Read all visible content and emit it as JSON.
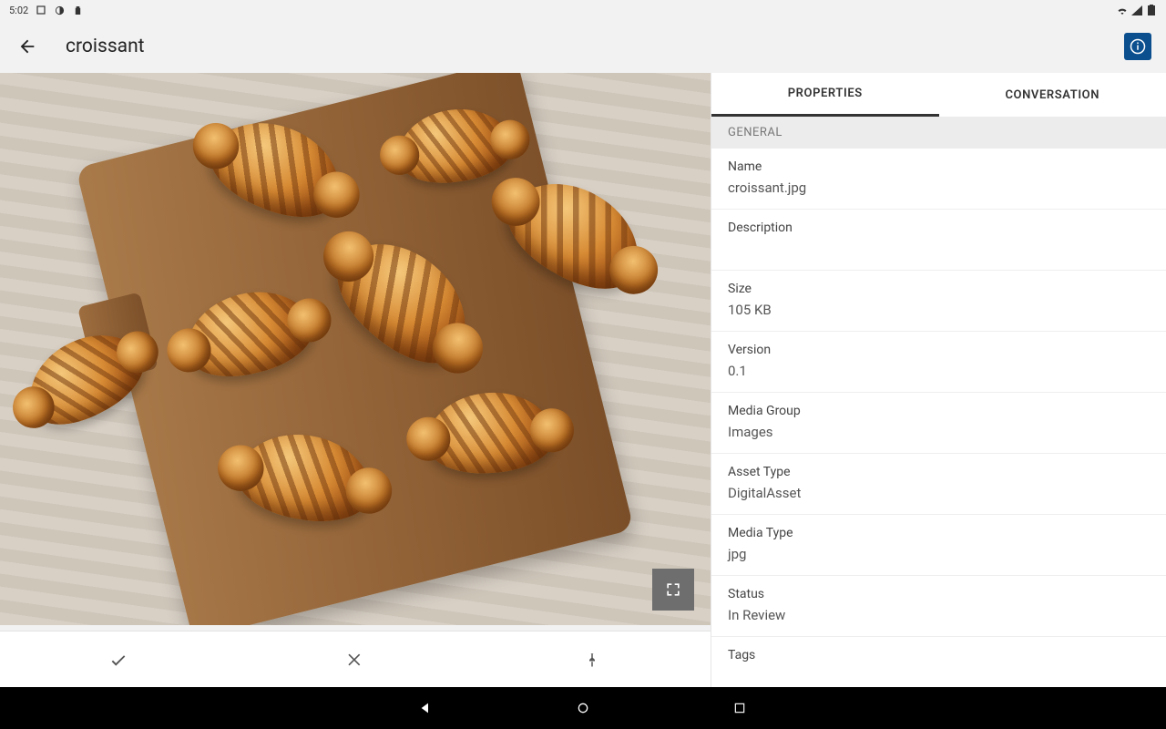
{
  "status": {
    "time": "5:02"
  },
  "header": {
    "title": "croissant"
  },
  "tabs": {
    "properties": "PROPERTIES",
    "conversation": "CONVERSATION"
  },
  "panel": {
    "section_general": "GENERAL",
    "fields": {
      "name_label": "Name",
      "name_value": "croissant.jpg",
      "description_label": "Description",
      "description_value": "",
      "size_label": "Size",
      "size_value": "105 KB",
      "version_label": "Version",
      "version_value": "0.1",
      "media_group_label": "Media Group",
      "media_group_value": "Images",
      "asset_type_label": "Asset Type",
      "asset_type_value": "DigitalAsset",
      "media_type_label": "Media Type",
      "media_type_value": "jpg",
      "status_label": "Status",
      "status_value": "In Review",
      "tags_label": "Tags",
      "tags_value": ""
    }
  }
}
